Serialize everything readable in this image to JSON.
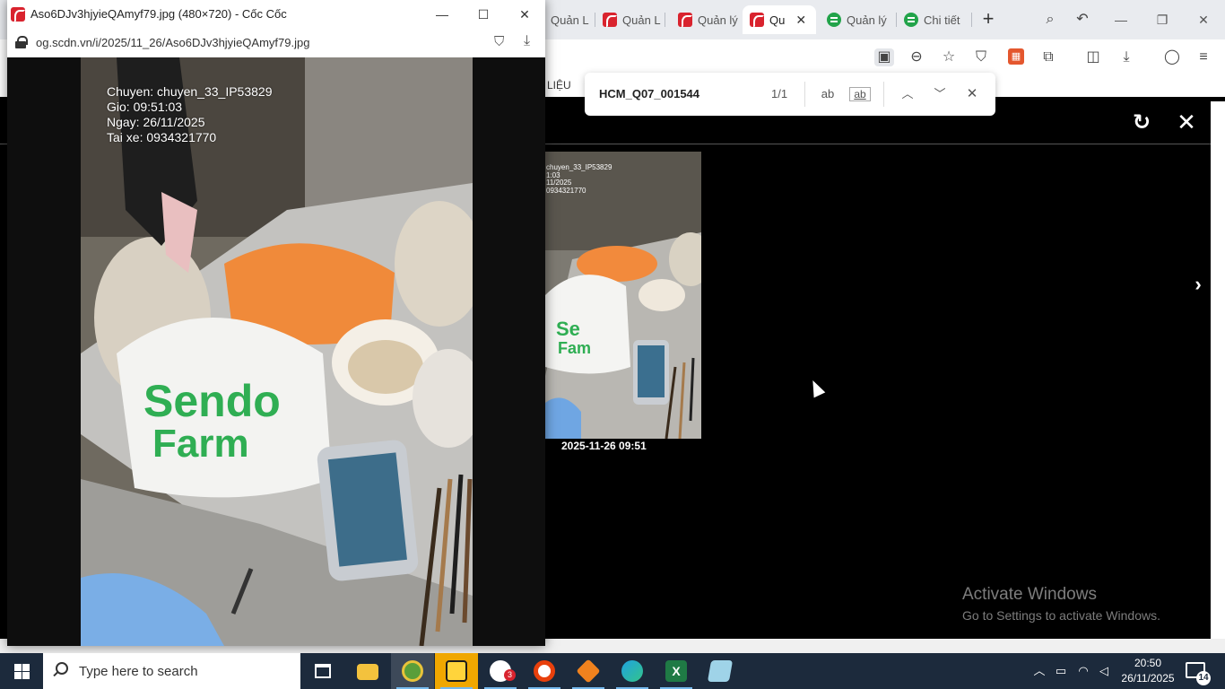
{
  "browser": {
    "tabs": [
      {
        "label": "Quản L",
        "icon": "red-app-icon"
      },
      {
        "label": "Quản L",
        "icon": "red-app-icon"
      },
      {
        "label": "Quản lý",
        "icon": "red-app-icon"
      },
      {
        "label": "Qu",
        "icon": "red-app-icon",
        "active": true
      },
      {
        "label": "Quản lý",
        "icon": "green-app-icon"
      },
      {
        "label": "Chi tiết",
        "icon": "green-app-icon"
      }
    ],
    "bookmark_label": "LIỆU"
  },
  "find_bar": {
    "query": "HCM_Q07_001544",
    "count": "1/1",
    "match_case_label": "ab",
    "whole_word_label": "ab"
  },
  "viewer": {
    "thumb_caption": "2025-11-26 09:51",
    "thumb_stamp": [
      "chuyen_33_IP53829",
      "1:03",
      "11/2025",
      "0934321770"
    ]
  },
  "popup": {
    "title": "Aso6DJv3hjyieQAmyf79.jpg (480×720) - Cốc Cốc",
    "url": "og.scdn.vn/i/2025/11_26/Aso6DJv3hjyieQAmyf79.jpg",
    "stamp": {
      "line1": "Chuyen: chuyen_33_IP53829",
      "line2": "Gio: 09:51:03",
      "line3": "Ngay: 26/11/2025",
      "line4": "Tai xe: 0934321770"
    }
  },
  "watermark": {
    "title": "Activate Windows",
    "subtitle": "Go to Settings to activate Windows."
  },
  "taskbar": {
    "search_placeholder": "Type here to search",
    "zalo_badge": "3",
    "time": "20:50",
    "date": "26/11/2025",
    "notification_count": "14"
  },
  "colors": {
    "accent_red": "#d9232e",
    "accent_green": "#22a34a",
    "taskbar_bg": "#1c2a3c"
  }
}
